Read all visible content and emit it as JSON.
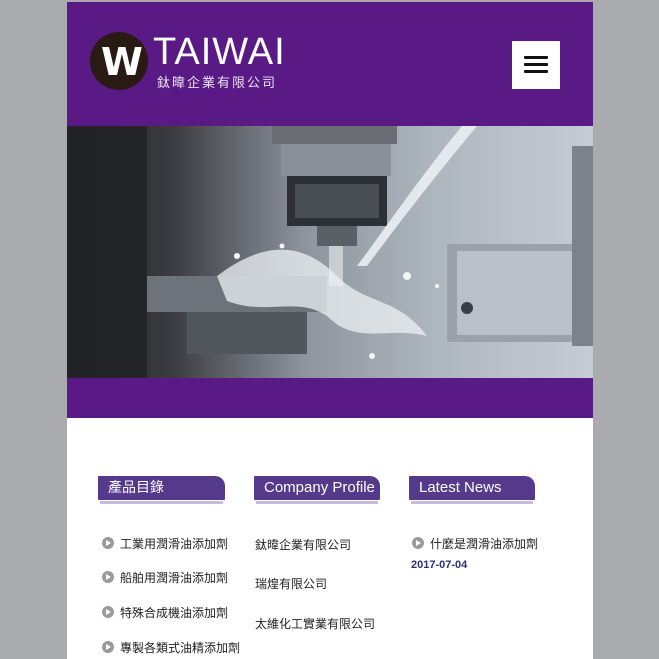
{
  "brand": {
    "logo_mark": "W",
    "logo_word": "TAIWAI",
    "logo_sub": "鈦暐企業有限公司"
  },
  "menu": {
    "icon": "hamburger-icon"
  },
  "colors": {
    "header_bg": "#5a1a85",
    "section_header_bg": "#553a8c",
    "date_color": "#2b2f7a",
    "side_bg": "#a9abae"
  },
  "products": {
    "title": "產品目錄",
    "items": [
      {
        "label": "工業用潤滑油添加劑"
      },
      {
        "label": "船舶用潤滑油添加劑"
      },
      {
        "label": "特殊合成機油添加劑"
      },
      {
        "label": "專製各類式油精添加劑"
      }
    ]
  },
  "company": {
    "title": "Company Profile",
    "items": [
      {
        "label": "鈦暐企業有限公司"
      },
      {
        "label": "瑞煌有限公司"
      },
      {
        "label": "太維化工實業有限公司"
      }
    ]
  },
  "news": {
    "title": "Latest News",
    "items": [
      {
        "label": "什麼是潤滑油添加劑",
        "date": "2017-07-04"
      }
    ]
  }
}
